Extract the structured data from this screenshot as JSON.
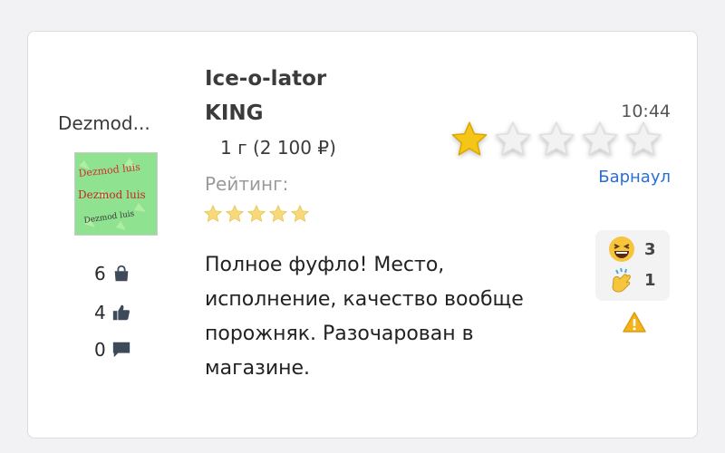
{
  "user": {
    "name": "Dezmod...",
    "avatar_text": [
      "Dezmod luis",
      "Dezmod luis",
      "Dezmod luis"
    ],
    "purchases": "6",
    "likes": "4",
    "comments": "0"
  },
  "product": {
    "title_line1": "Ice-o-lator",
    "title_line2": "KING",
    "price": "1 г (2 100 ₽)",
    "rating_label": "Рейтинг:",
    "rating_small": 5
  },
  "review": {
    "time": "10:44",
    "city": "Барнаул",
    "rating": 1,
    "rating_max": 5,
    "text": "Полное фуфло! Место, исполнение, качество вообще порожняк. Разочарован в магазине."
  },
  "reactions": [
    {
      "icon": "laughing-emoji-icon",
      "count": "3"
    },
    {
      "icon": "clapping-emoji-icon",
      "count": "1"
    }
  ],
  "colors": {
    "star_filled": "#f5c518",
    "star_empty": "#f2f2f2",
    "small_star": "#f7d97a",
    "city_link": "#2a6fd6",
    "warning": "#f3b51b"
  }
}
